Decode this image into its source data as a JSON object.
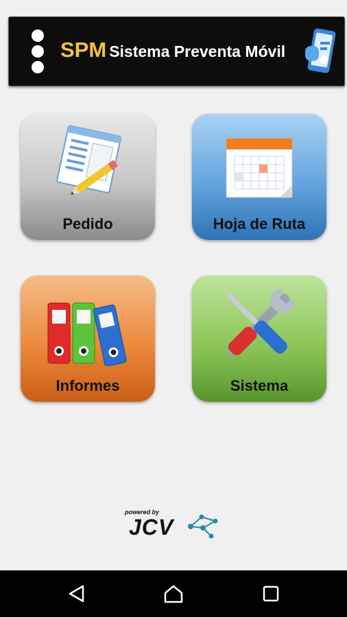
{
  "app": {
    "brand": "SPM",
    "subtitle": "Sistema Preventa Móvil"
  },
  "menu": {
    "tiles": [
      {
        "label": "Pedido",
        "icon": "order-form-icon",
        "color": "#a8a8a8"
      },
      {
        "label": "Hoja de Ruta",
        "icon": "calendar-icon",
        "color": "#4a8fd0"
      },
      {
        "label": "Informes",
        "icon": "binders-icon",
        "color": "#e57f2f"
      },
      {
        "label": "Sistema",
        "icon": "tools-icon",
        "color": "#7cb84a"
      }
    ]
  },
  "footer": {
    "powered_by": "powered by",
    "company": "JCV"
  },
  "navigation": {
    "back": "back-icon",
    "home": "home-icon",
    "recents": "recents-icon"
  },
  "colors": {
    "header_bg": "#0d0d0d",
    "brand_accent": "#f5c242",
    "page_bg": "#f0f0f0"
  }
}
